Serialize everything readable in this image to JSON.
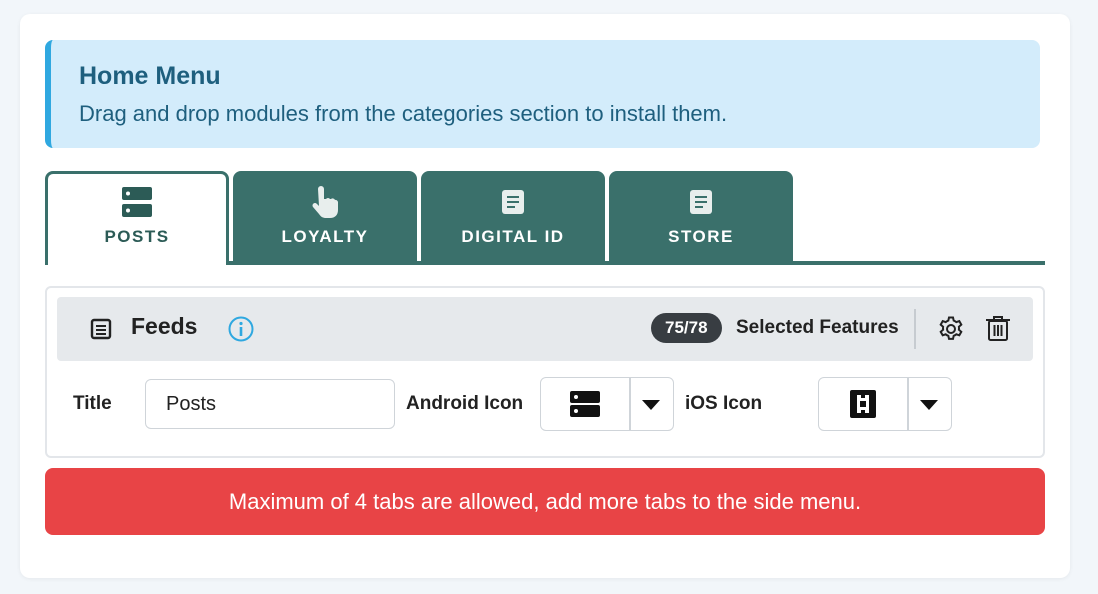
{
  "header": {
    "title": "Home Menu",
    "description": "Drag and drop modules from the categories section to install them."
  },
  "tabs": [
    {
      "label": "POSTS",
      "icon": "server-icon",
      "active": true
    },
    {
      "label": "LOYALTY",
      "icon": "hand-pointer-icon",
      "active": false
    },
    {
      "label": "DIGITAL ID",
      "icon": "document-icon",
      "active": false
    },
    {
      "label": "STORE",
      "icon": "document-icon",
      "active": false
    }
  ],
  "panel": {
    "section_title": "Feeds",
    "section_icon": "list-icon",
    "info_icon": "info-circle-icon",
    "count_badge": "75/78",
    "selected_label": "Selected Features",
    "settings_icon": "gear-icon",
    "delete_icon": "trash-icon",
    "fields": {
      "title_label": "Title",
      "title_value": "Posts",
      "android_label": "Android Icon",
      "android_icon": "server-icon",
      "ios_label": "iOS Icon",
      "ios_icon": "frame-corners-icon"
    }
  },
  "error_message": "Maximum of 4 tabs are allowed, add more tabs to the side menu.",
  "colors": {
    "tab_teal": "#3a706b",
    "info_bg": "#d3ecfb",
    "info_accent": "#2fa8e0",
    "danger": "#e84446",
    "badge_dark": "#383d42"
  }
}
